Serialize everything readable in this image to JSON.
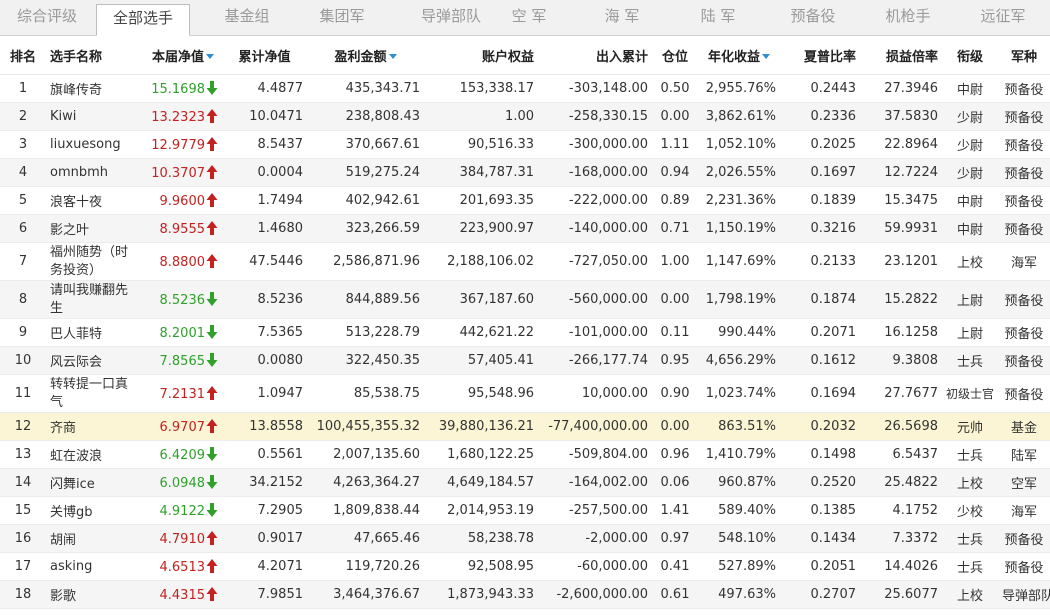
{
  "tabs": [
    {
      "label": "综合评级",
      "active": false
    },
    {
      "label": "全部选手",
      "active": true
    },
    {
      "label": "基金组",
      "active": false
    },
    {
      "label": "集团军",
      "active": false
    },
    {
      "label": "导弹部队",
      "active": false
    },
    {
      "label": "空  军",
      "active": false
    },
    {
      "label": "海  军",
      "active": false
    },
    {
      "label": "陆  军",
      "active": false
    },
    {
      "label": "预备役",
      "active": false
    },
    {
      "label": "机枪手",
      "active": false
    },
    {
      "label": "远征军",
      "active": false
    }
  ],
  "headers": [
    "排名",
    "选手名称",
    "本届净值",
    "累计净值",
    "盈利金额",
    "账户权益",
    "出入累计",
    "仓位",
    "年化收益",
    "夏普比率",
    "损益倍率",
    "衔级",
    "军种"
  ],
  "sortable": [
    "本届净值",
    "盈利金额",
    "年化收益"
  ],
  "colors": {
    "up": "#c32220",
    "down": "#2fa12b",
    "highlight": "#fbf5d5"
  },
  "rows": [
    {
      "rank": "1",
      "name": "旗峰传奇",
      "nav": "15.1698",
      "dir": "down",
      "cum_nav": "4.4877",
      "profit": "435,343.71",
      "equity": "153,338.17",
      "inout": "-303,148.00",
      "position": "0.50",
      "annual": "2,955.76%",
      "sharpe": "0.2443",
      "pl_ratio": "27.3946",
      "grade": "中尉",
      "branch": "预备役"
    },
    {
      "rank": "2",
      "name": "Kiwi",
      "nav": "13.2323",
      "dir": "up",
      "cum_nav": "10.0471",
      "profit": "238,808.43",
      "equity": "1.00",
      "inout": "-258,330.15",
      "position": "0.00",
      "annual": "3,862.61%",
      "sharpe": "0.2336",
      "pl_ratio": "37.5830",
      "grade": "少尉",
      "branch": "预备役"
    },
    {
      "rank": "3",
      "name": "liuxuesong",
      "nav": "12.9779",
      "dir": "up",
      "cum_nav": "8.5437",
      "profit": "370,667.61",
      "equity": "90,516.33",
      "inout": "-300,000.00",
      "position": "1.11",
      "annual": "1,052.10%",
      "sharpe": "0.2025",
      "pl_ratio": "22.8964",
      "grade": "少尉",
      "branch": "预备役"
    },
    {
      "rank": "4",
      "name": "omnbmh",
      "nav": "10.3707",
      "dir": "up",
      "cum_nav": "0.0004",
      "profit": "519,275.24",
      "equity": "384,787.31",
      "inout": "-168,000.00",
      "position": "0.94",
      "annual": "2,026.55%",
      "sharpe": "0.1697",
      "pl_ratio": "12.7224",
      "grade": "少尉",
      "branch": "预备役"
    },
    {
      "rank": "5",
      "name": "浪客十夜",
      "nav": "9.9600",
      "dir": "up",
      "cum_nav": "1.7494",
      "profit": "402,942.61",
      "equity": "201,693.35",
      "inout": "-222,000.00",
      "position": "0.89",
      "annual": "2,231.36%",
      "sharpe": "0.1839",
      "pl_ratio": "15.3475",
      "grade": "中尉",
      "branch": "预备役"
    },
    {
      "rank": "6",
      "name": "影之叶",
      "nav": "8.9555",
      "dir": "up",
      "cum_nav": "1.4680",
      "profit": "323,266.59",
      "equity": "223,900.97",
      "inout": "-140,000.00",
      "position": "0.71",
      "annual": "1,150.19%",
      "sharpe": "0.3216",
      "pl_ratio": "59.9931",
      "grade": "中尉",
      "branch": "预备役"
    },
    {
      "rank": "7",
      "name": "福州随势（时务投资）",
      "nav": "8.8800",
      "dir": "up",
      "cum_nav": "47.5446",
      "profit": "2,586,871.96",
      "equity": "2,188,106.02",
      "inout": "-727,050.00",
      "position": "1.00",
      "annual": "1,147.69%",
      "sharpe": "0.2133",
      "pl_ratio": "23.1201",
      "grade": "上校",
      "branch": "海军"
    },
    {
      "rank": "8",
      "name": "请叫我赚翻先生",
      "nav": "8.5236",
      "dir": "down",
      "cum_nav": "8.5236",
      "profit": "844,889.56",
      "equity": "367,187.60",
      "inout": "-560,000.00",
      "position": "0.00",
      "annual": "1,798.19%",
      "sharpe": "0.1874",
      "pl_ratio": "15.2822",
      "grade": "上尉",
      "branch": "预备役"
    },
    {
      "rank": "9",
      "name": "巴人菲特",
      "nav": "8.2001",
      "dir": "down",
      "cum_nav": "7.5365",
      "profit": "513,228.79",
      "equity": "442,621.22",
      "inout": "-101,000.00",
      "position": "0.11",
      "annual": "990.44%",
      "sharpe": "0.2071",
      "pl_ratio": "16.1258",
      "grade": "上尉",
      "branch": "预备役"
    },
    {
      "rank": "10",
      "name": "风云际会",
      "nav": "7.8565",
      "dir": "down",
      "cum_nav": "0.0080",
      "profit": "322,450.35",
      "equity": "57,405.41",
      "inout": "-266,177.74",
      "position": "0.95",
      "annual": "4,656.29%",
      "sharpe": "0.1612",
      "pl_ratio": "9.3808",
      "grade": "士兵",
      "branch": "预备役"
    },
    {
      "rank": "11",
      "name": "转转提一口真气",
      "nav": "7.2131",
      "dir": "up",
      "cum_nav": "1.0947",
      "profit": "85,538.75",
      "equity": "95,548.96",
      "inout": "10,000.00",
      "position": "0.90",
      "annual": "1,023.74%",
      "sharpe": "0.1694",
      "pl_ratio": "27.7677",
      "grade": "初级士官",
      "branch": "预备役"
    },
    {
      "rank": "12",
      "name": "齐商",
      "nav": "6.9707",
      "dir": "up",
      "cum_nav": "13.8558",
      "profit": "100,455,355.32",
      "equity": "39,880,136.21",
      "inout": "-77,400,000.00",
      "position": "0.00",
      "annual": "863.51%",
      "sharpe": "0.2032",
      "pl_ratio": "26.5698",
      "grade": "元帅",
      "branch": "基金"
    },
    {
      "rank": "13",
      "name": "虹在波浪",
      "nav": "6.4209",
      "dir": "down",
      "cum_nav": "0.5561",
      "profit": "2,007,135.60",
      "equity": "1,680,122.25",
      "inout": "-509,804.00",
      "position": "0.96",
      "annual": "1,410.79%",
      "sharpe": "0.1498",
      "pl_ratio": "6.5437",
      "grade": "士兵",
      "branch": "陆军"
    },
    {
      "rank": "14",
      "name": "闪舞ice",
      "nav": "6.0948",
      "dir": "down",
      "cum_nav": "34.2152",
      "profit": "4,263,364.27",
      "equity": "4,649,184.57",
      "inout": "-164,002.00",
      "position": "0.06",
      "annual": "960.87%",
      "sharpe": "0.2520",
      "pl_ratio": "25.4822",
      "grade": "上校",
      "branch": "空军"
    },
    {
      "rank": "15",
      "name": "关博gb",
      "nav": "4.9122",
      "dir": "down",
      "cum_nav": "7.2905",
      "profit": "1,809,838.44",
      "equity": "2,014,953.19",
      "inout": "-257,500.00",
      "position": "1.41",
      "annual": "589.40%",
      "sharpe": "0.1385",
      "pl_ratio": "4.1752",
      "grade": "少校",
      "branch": "海军"
    },
    {
      "rank": "16",
      "name": "胡闹",
      "nav": "4.7910",
      "dir": "up",
      "cum_nav": "0.9017",
      "profit": "47,665.46",
      "equity": "58,238.78",
      "inout": "-2,000.00",
      "position": "0.97",
      "annual": "548.10%",
      "sharpe": "0.1434",
      "pl_ratio": "7.3372",
      "grade": "士兵",
      "branch": "预备役"
    },
    {
      "rank": "17",
      "name": "asking",
      "nav": "4.6513",
      "dir": "up",
      "cum_nav": "4.2071",
      "profit": "119,720.26",
      "equity": "92,508.95",
      "inout": "-60,000.00",
      "position": "0.41",
      "annual": "527.89%",
      "sharpe": "0.2051",
      "pl_ratio": "14.4026",
      "grade": "士兵",
      "branch": "预备役"
    },
    {
      "rank": "18",
      "name": "影歌",
      "nav": "4.4315",
      "dir": "up",
      "cum_nav": "7.9851",
      "profit": "3,464,376.67",
      "equity": "1,873,943.33",
      "inout": "-2,600,000.00",
      "position": "0.61",
      "annual": "497.63%",
      "sharpe": "0.2707",
      "pl_ratio": "25.6077",
      "grade": "上校",
      "branch": "导弹部队"
    }
  ]
}
